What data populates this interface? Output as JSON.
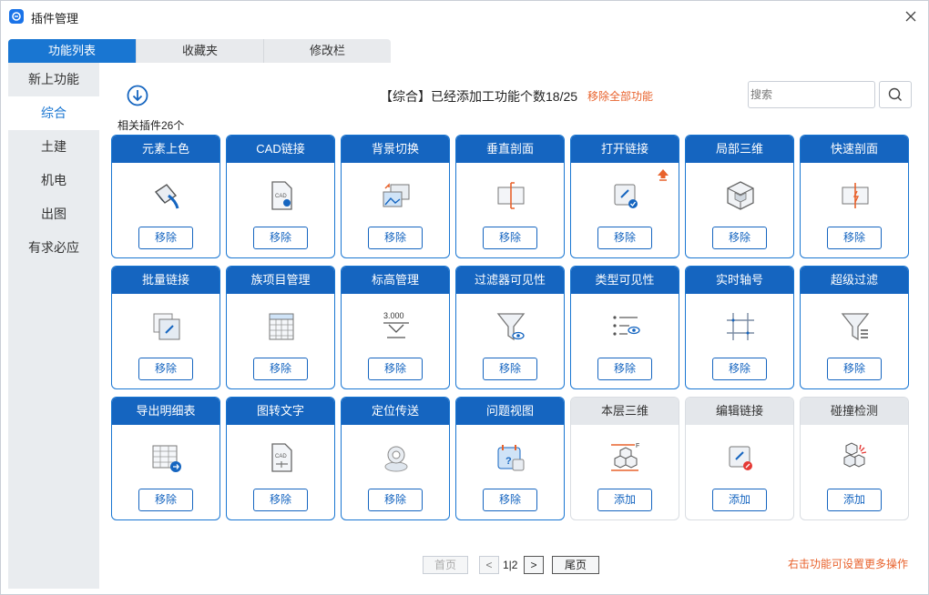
{
  "window": {
    "title": "插件管理"
  },
  "tabs": [
    {
      "label": "功能列表",
      "active": true
    },
    {
      "label": "收藏夹",
      "active": false
    },
    {
      "label": "修改栏",
      "active": false
    }
  ],
  "sidebar": {
    "items": [
      {
        "label": "新上功能",
        "active": false
      },
      {
        "label": "综合",
        "active": true
      },
      {
        "label": "土建",
        "active": false
      },
      {
        "label": "机电",
        "active": false
      },
      {
        "label": "出图",
        "active": false
      },
      {
        "label": "有求必应",
        "active": false
      }
    ]
  },
  "header": {
    "summary": "【综合】已经添加工功能个数18/25",
    "remove_all": "移除全部功能",
    "search_placeholder": "搜索",
    "count_label": "相关插件26个"
  },
  "cards": [
    {
      "title": "元素上色",
      "button": "移除",
      "added": true,
      "icon": "paint-bucket-icon"
    },
    {
      "title": "CAD链接",
      "button": "移除",
      "added": true,
      "icon": "cad-file-link-icon"
    },
    {
      "title": "背景切换",
      "button": "移除",
      "added": true,
      "icon": "image-swap-icon"
    },
    {
      "title": "垂直剖面",
      "button": "移除",
      "added": true,
      "icon": "vertical-section-icon"
    },
    {
      "title": "打开链接",
      "button": "移除",
      "added": true,
      "icon": "open-link-icon",
      "upgrade": true
    },
    {
      "title": "局部三维",
      "button": "移除",
      "added": true,
      "icon": "local-3d-box-icon"
    },
    {
      "title": "快速剖面",
      "button": "移除",
      "added": true,
      "icon": "quick-section-icon"
    },
    {
      "title": "批量链接",
      "button": "移除",
      "added": true,
      "icon": "batch-link-icon"
    },
    {
      "title": "族项目管理",
      "button": "移除",
      "added": true,
      "icon": "family-grid-icon"
    },
    {
      "title": "标高管理",
      "button": "移除",
      "added": true,
      "icon": "elevation-mark-icon",
      "icon_text": "3.000"
    },
    {
      "title": "过滤器可见性",
      "button": "移除",
      "added": true,
      "icon": "filter-eye-icon"
    },
    {
      "title": "类型可见性",
      "button": "移除",
      "added": true,
      "icon": "list-eye-icon"
    },
    {
      "title": "实时轴号",
      "button": "移除",
      "added": true,
      "icon": "axis-grid-icon"
    },
    {
      "title": "超级过滤",
      "button": "移除",
      "added": true,
      "icon": "super-filter-icon"
    },
    {
      "title": "导出明细表",
      "button": "移除",
      "added": true,
      "icon": "export-table-icon"
    },
    {
      "title": "图转文字",
      "button": "移除",
      "added": true,
      "icon": "cad-to-text-icon"
    },
    {
      "title": "定位传送",
      "button": "移除",
      "added": true,
      "icon": "location-pin-icon"
    },
    {
      "title": "问题视图",
      "button": "移除",
      "added": true,
      "icon": "issue-calendar-icon"
    },
    {
      "title": "本层三维",
      "button": "添加",
      "added": false,
      "icon": "floor-3d-icon"
    },
    {
      "title": "编辑链接",
      "button": "添加",
      "added": false,
      "icon": "edit-link-icon"
    },
    {
      "title": "碰撞检测",
      "button": "添加",
      "added": false,
      "icon": "collision-check-icon"
    }
  ],
  "pager": {
    "first": "首页",
    "prev": "<",
    "info": "1|2",
    "next": ">",
    "last": "尾页"
  },
  "footer_hint": "右击功能可设置更多操作",
  "colors": {
    "primary": "#1565c0",
    "accent": "#e8622c",
    "inactive_header": "#e4e7eb"
  }
}
